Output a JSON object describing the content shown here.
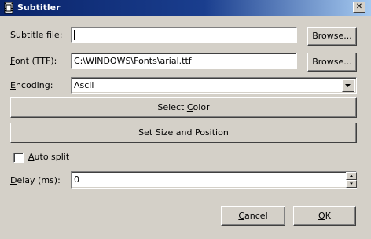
{
  "window": {
    "title": "Subtitler",
    "close_glyph": "✕"
  },
  "subtitle_file": {
    "label_pre": "",
    "label_key": "S",
    "label_post": "ubtitle file:",
    "value": "",
    "browse_label": "Browse..."
  },
  "font": {
    "label_pre": "",
    "label_key": "F",
    "label_post": "ont (TTF):",
    "value": "C:\\WINDOWS\\Fonts\\arial.ttf",
    "browse_label": "Browse..."
  },
  "encoding": {
    "label_pre": "",
    "label_key": "E",
    "label_post": "ncoding:",
    "selected": "Ascii"
  },
  "select_color": {
    "label_pre": "Select ",
    "label_key": "C",
    "label_post": "olor"
  },
  "set_size_position": {
    "label": "Set Size and Position"
  },
  "auto_split": {
    "label_pre": "",
    "label_key": "A",
    "label_post": "uto split",
    "checked": false
  },
  "delay": {
    "label_pre": "",
    "label_key": "D",
    "label_post": "elay (ms):",
    "value": "0"
  },
  "buttons": {
    "cancel_pre": "",
    "cancel_key": "C",
    "cancel_post": "ancel",
    "ok_pre": "",
    "ok_key": "O",
    "ok_post": "K"
  },
  "icons": {
    "app": "film-icon",
    "close": "close-icon",
    "dropdown": "chevron-down-icon",
    "spin_up": "arrow-up-icon",
    "spin_down": "arrow-down-icon"
  }
}
